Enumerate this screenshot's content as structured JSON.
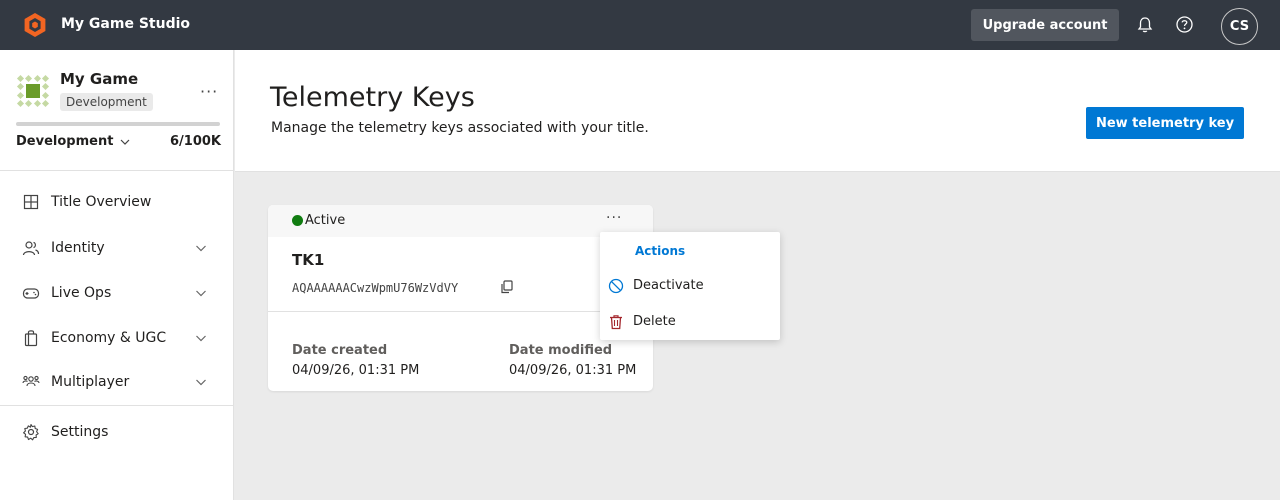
{
  "topbar": {
    "studio_name": "My Game Studio",
    "upgrade_label": "Upgrade account",
    "avatar_initials": "CS"
  },
  "sidebar": {
    "game_name": "My Game",
    "env_badge": "Development",
    "environment": "Development",
    "usage": "6/100K",
    "usage_fraction": 6e-05,
    "items": [
      {
        "label": "Title Overview",
        "icon": "grid-icon",
        "expandable": false
      },
      {
        "label": "Identity",
        "icon": "people-icon",
        "expandable": true
      },
      {
        "label": "Live Ops",
        "icon": "gamepad-icon",
        "expandable": true
      },
      {
        "label": "Economy & UGC",
        "icon": "bag-icon",
        "expandable": true
      },
      {
        "label": "Multiplayer",
        "icon": "multiplayer-icon",
        "expandable": true
      },
      {
        "label": "Settings",
        "icon": "gear-icon",
        "expandable": false
      }
    ]
  },
  "header": {
    "title": "Telemetry Keys",
    "subtitle": "Manage the telemetry keys associated with your title.",
    "new_key_label": "New telemetry key"
  },
  "card": {
    "status": "Active",
    "status_color": "#107c10",
    "key_name": "TK1",
    "key_value": "AQAAAAAACwzWpmU76WzVdVY",
    "date_created_label": "Date created",
    "date_created": "04/09/26, 01:31 PM",
    "date_modified_label": "Date modified",
    "date_modified": "04/09/26, 01:31 PM"
  },
  "menu": {
    "header": "Actions",
    "items": [
      {
        "label": "Deactivate",
        "icon": "block-icon"
      },
      {
        "label": "Delete",
        "icon": "trash-icon"
      }
    ]
  },
  "colors": {
    "topbar": "#333942",
    "accent": "#0078d4",
    "logo": "#f26522",
    "game_logo_green": "#6b9c2a",
    "delete_red": "#a4262c"
  }
}
